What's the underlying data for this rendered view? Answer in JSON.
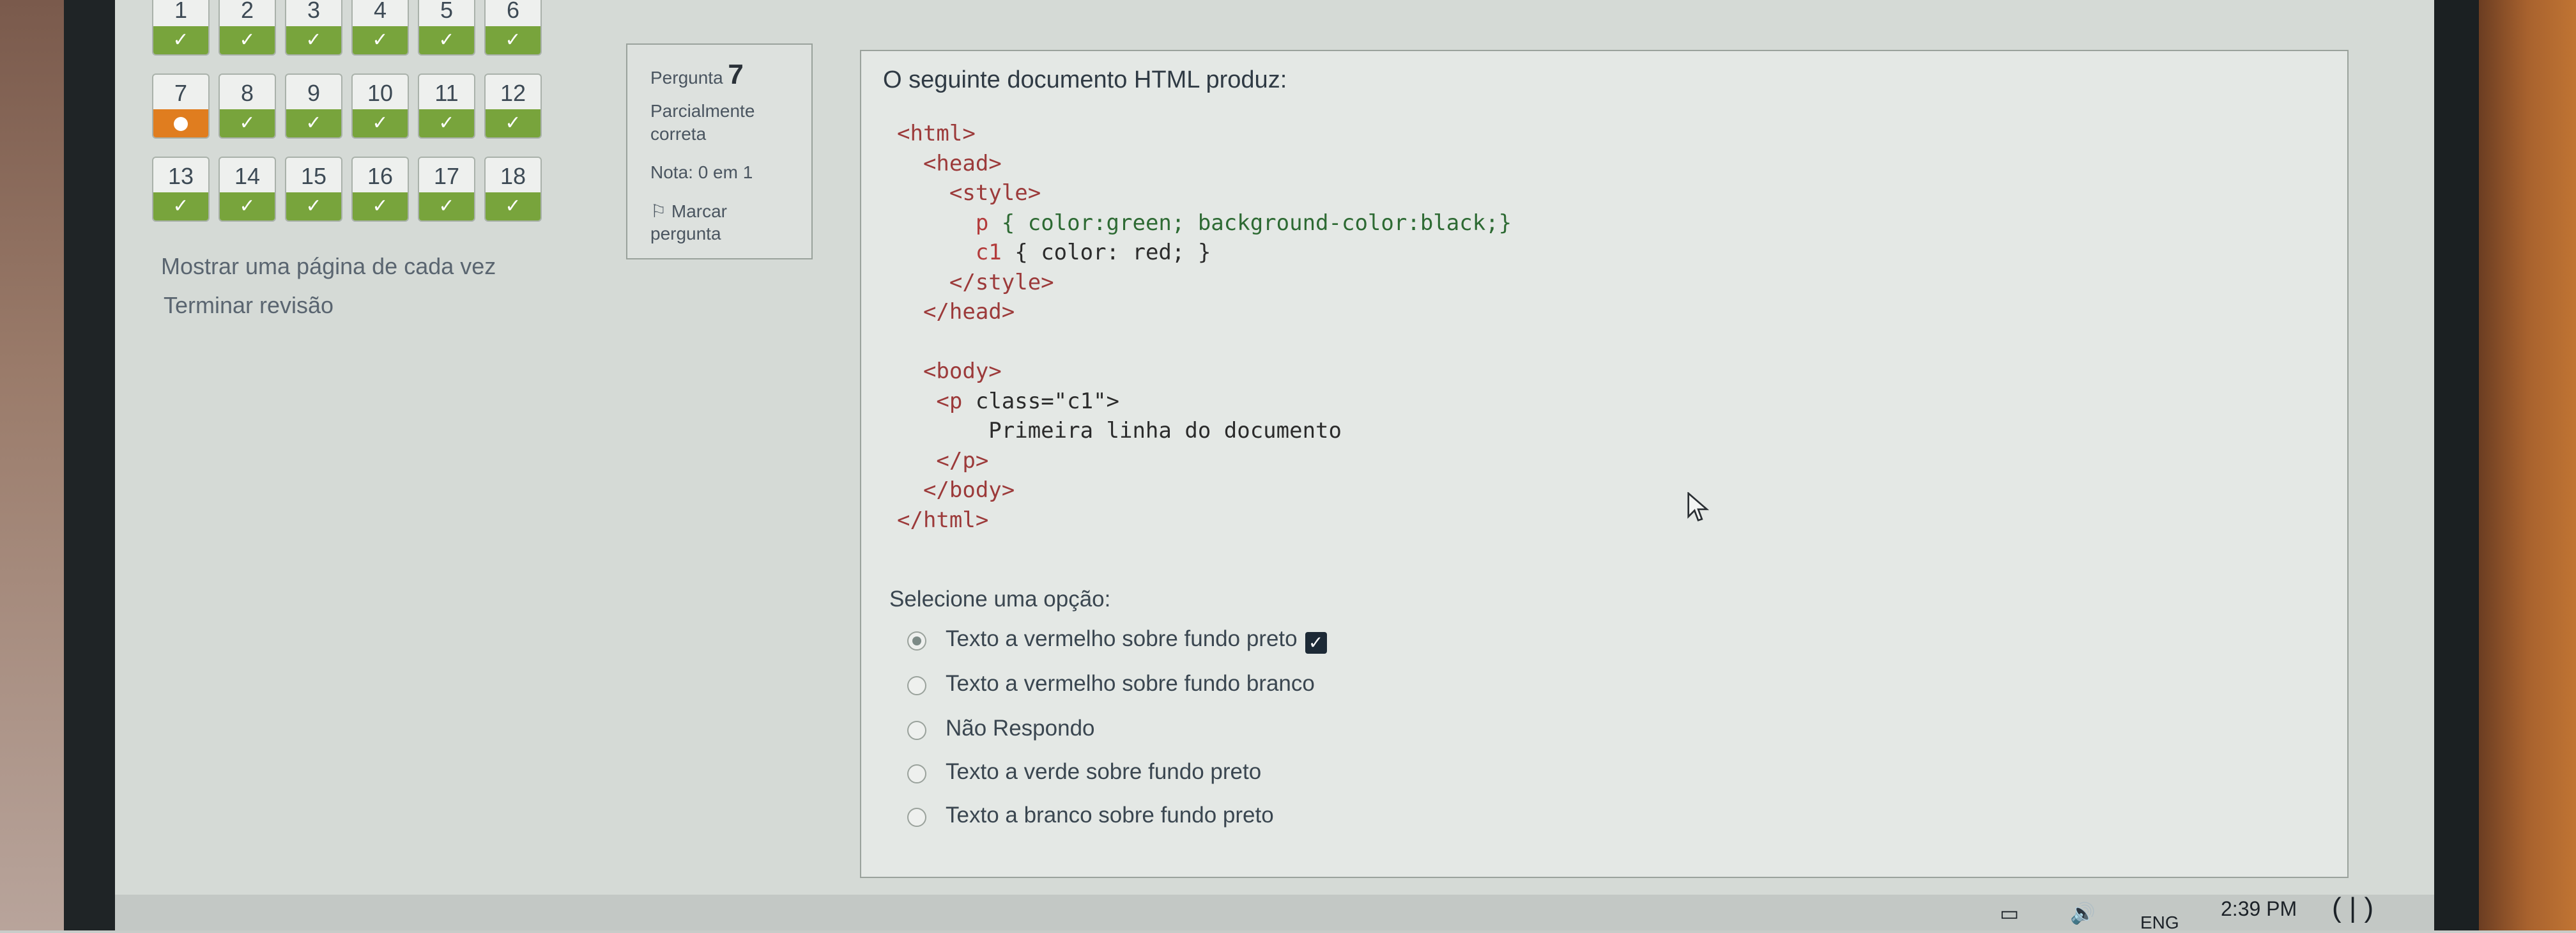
{
  "quiz_nav": {
    "questions": [
      {
        "num": "1",
        "state": "correct"
      },
      {
        "num": "2",
        "state": "correct"
      },
      {
        "num": "3",
        "state": "correct"
      },
      {
        "num": "4",
        "state": "correct"
      },
      {
        "num": "5",
        "state": "correct"
      },
      {
        "num": "6",
        "state": "correct"
      },
      {
        "num": "7",
        "state": "partial"
      },
      {
        "num": "8",
        "state": "correct"
      },
      {
        "num": "9",
        "state": "correct"
      },
      {
        "num": "10",
        "state": "correct"
      },
      {
        "num": "11",
        "state": "correct"
      },
      {
        "num": "12",
        "state": "correct"
      },
      {
        "num": "13",
        "state": "correct"
      },
      {
        "num": "14",
        "state": "correct"
      },
      {
        "num": "15",
        "state": "correct"
      },
      {
        "num": "16",
        "state": "correct"
      },
      {
        "num": "17",
        "state": "correct"
      },
      {
        "num": "18",
        "state": "correct"
      }
    ],
    "show_one_page_link": "Mostrar uma página de cada vez",
    "finish_review_link": "Terminar revisão"
  },
  "question_info": {
    "label": "Pergunta",
    "number": "7",
    "status_line1": "Parcialmente",
    "status_line2": "correta",
    "grade": "Nota: 0 em 1",
    "flag_line1": "Marcar",
    "flag_line2": "pergunta"
  },
  "question": {
    "prompt": "O seguinte documento HTML produz:",
    "code": {
      "l1": "<html>",
      "l2": "<head>",
      "l3": "<style>",
      "l4_sel": "p",
      "l4_body": " { color:green; background-color:black;}",
      "l5_sel": "c1",
      "l5_body": " { color: red; }",
      "l6": "</style>",
      "l7": "</head>",
      "l8": "<body>",
      "l9_open": "<p ",
      "l9_attr": "class=\"c1\">",
      "l10": "Primeira linha do documento",
      "l11": "</p>",
      "l12": "</body>",
      "l13": "</html>"
    },
    "options_title": "Selecione uma opção:",
    "options": [
      {
        "label": "Texto a vermelho sobre fundo preto",
        "selected": true
      },
      {
        "label": "Texto a vermelho sobre fundo branco",
        "selected": false
      },
      {
        "label": "Não Respondo",
        "selected": false
      },
      {
        "label": "Texto a verde sobre fundo preto",
        "selected": false
      },
      {
        "label": "Texto a branco sobre fundo preto",
        "selected": false
      }
    ]
  },
  "taskbar": {
    "lang": "ENG",
    "time": "2:39 PM"
  },
  "colors": {
    "correct": "#78a43c",
    "partial": "#e07d1f"
  }
}
